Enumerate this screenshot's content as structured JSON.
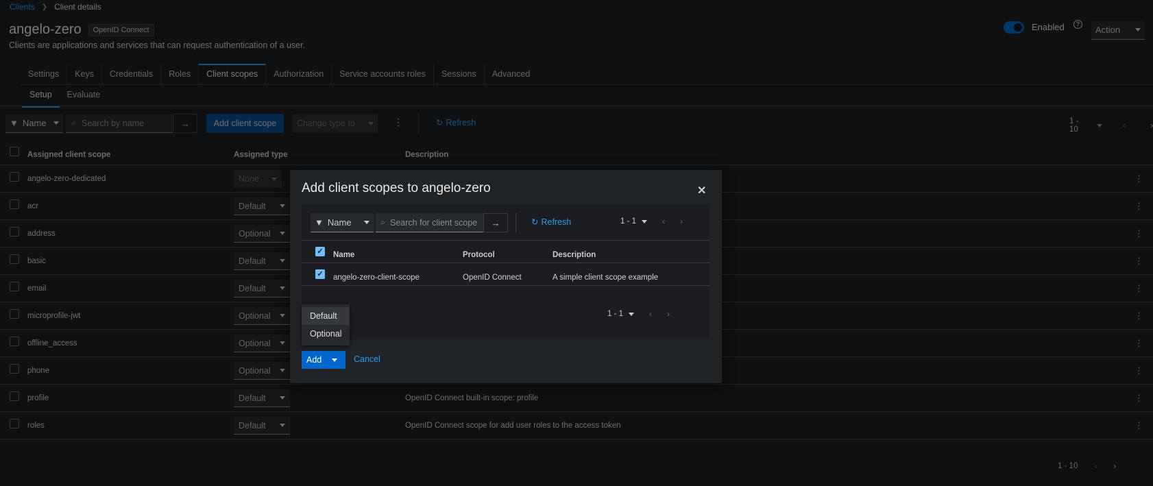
{
  "breadcrumb": {
    "root": "Clients",
    "current": "Client details"
  },
  "client": {
    "name": "angelo-zero",
    "protocol_badge": "OpenID Connect",
    "description": "Clients are applications and services that can request authentication of a user.",
    "enabled_label": "Enabled",
    "action_label": "Action"
  },
  "tabs": [
    "Settings",
    "Keys",
    "Credentials",
    "Roles",
    "Client scopes",
    "Authorization",
    "Service accounts roles",
    "Sessions",
    "Advanced"
  ],
  "subtabs": [
    "Setup",
    "Evaluate"
  ],
  "toolbar": {
    "filter_label": "Name",
    "search_placeholder": "Search by name",
    "add_label": "Add client scope",
    "change_type_label": "Change type to",
    "refresh_label": "Refresh",
    "pagination": "1 - 10"
  },
  "table": {
    "headers": {
      "scope": "Assigned client scope",
      "type": "Assigned type",
      "description": "Description"
    },
    "rows": [
      {
        "name": "angelo-zero-dedicated",
        "type": "None",
        "description": ""
      },
      {
        "name": "acr",
        "type": "Default",
        "description": ""
      },
      {
        "name": "address",
        "type": "Optional",
        "description": ""
      },
      {
        "name": "basic",
        "type": "Default",
        "description": ""
      },
      {
        "name": "email",
        "type": "Default",
        "description": ""
      },
      {
        "name": "microprofile-jwt",
        "type": "Optional",
        "description": ""
      },
      {
        "name": "offline_access",
        "type": "Optional",
        "description": ""
      },
      {
        "name": "phone",
        "type": "Optional",
        "description": ""
      },
      {
        "name": "profile",
        "type": "Default",
        "description": "OpenID Connect built-in scope: profile"
      },
      {
        "name": "roles",
        "type": "Default",
        "description": "OpenID Connect scope for add user roles to the access token"
      }
    ],
    "pagination_bottom": "1 - 10"
  },
  "modal": {
    "title": "Add client scopes to angelo-zero",
    "filter_label": "Name",
    "search_placeholder": "Search for client scope",
    "refresh_label": "Refresh",
    "pagination": "1 - 1",
    "headers": {
      "name": "Name",
      "protocol": "Protocol",
      "description": "Description"
    },
    "rows": [
      {
        "name": "angelo-zero-client-scope",
        "protocol": "OpenID Connect",
        "description": "A simple client scope example"
      }
    ],
    "pagination_bottom": "1 - 1",
    "dropdown": [
      "Default",
      "Optional"
    ],
    "add_label": "Add",
    "cancel_label": "Cancel"
  }
}
